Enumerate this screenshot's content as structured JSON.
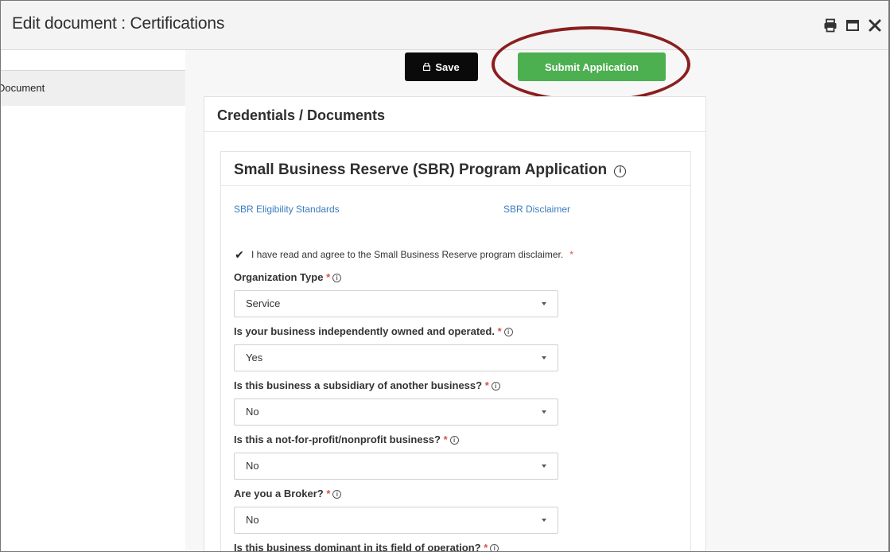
{
  "window": {
    "title": "Edit document : Certifications",
    "icons": [
      "print-icon",
      "maximize-icon",
      "close-icon"
    ]
  },
  "sidebar": {
    "item_label": "Document"
  },
  "toolbar": {
    "save_label": "Save",
    "submit_label": "Submit Application"
  },
  "card": {
    "title": "Credentials / Documents"
  },
  "application": {
    "title": "Small Business Reserve (SBR) Program Application",
    "info_symbol": "i",
    "links": [
      {
        "label": "SBR Eligibility Standards"
      },
      {
        "label": "SBR Disclaimer"
      }
    ],
    "agree": {
      "checked": true,
      "check_glyph": "✔",
      "text": "I have read and agree to the Small Business Reserve program disclaimer.",
      "required_mark": "*"
    },
    "fields": [
      {
        "label": "Organization Type",
        "value": "Service"
      },
      {
        "label": "Is your business independently owned and operated.",
        "value": "Yes"
      },
      {
        "label": "Is this business a subsidiary of another business?",
        "value": "No"
      },
      {
        "label": "Is this a not-for-profit/nonprofit business?",
        "value": "No"
      },
      {
        "label": "Are you a Broker?",
        "value": "No"
      },
      {
        "label": "Is this business dominant in its field of operation?",
        "value": ""
      }
    ]
  },
  "colors": {
    "submit": "#4caf50",
    "save": "#0a0a0a",
    "link": "#3b7bbf",
    "required": "#d9534f",
    "highlight_circle": "#8b1e1e"
  }
}
